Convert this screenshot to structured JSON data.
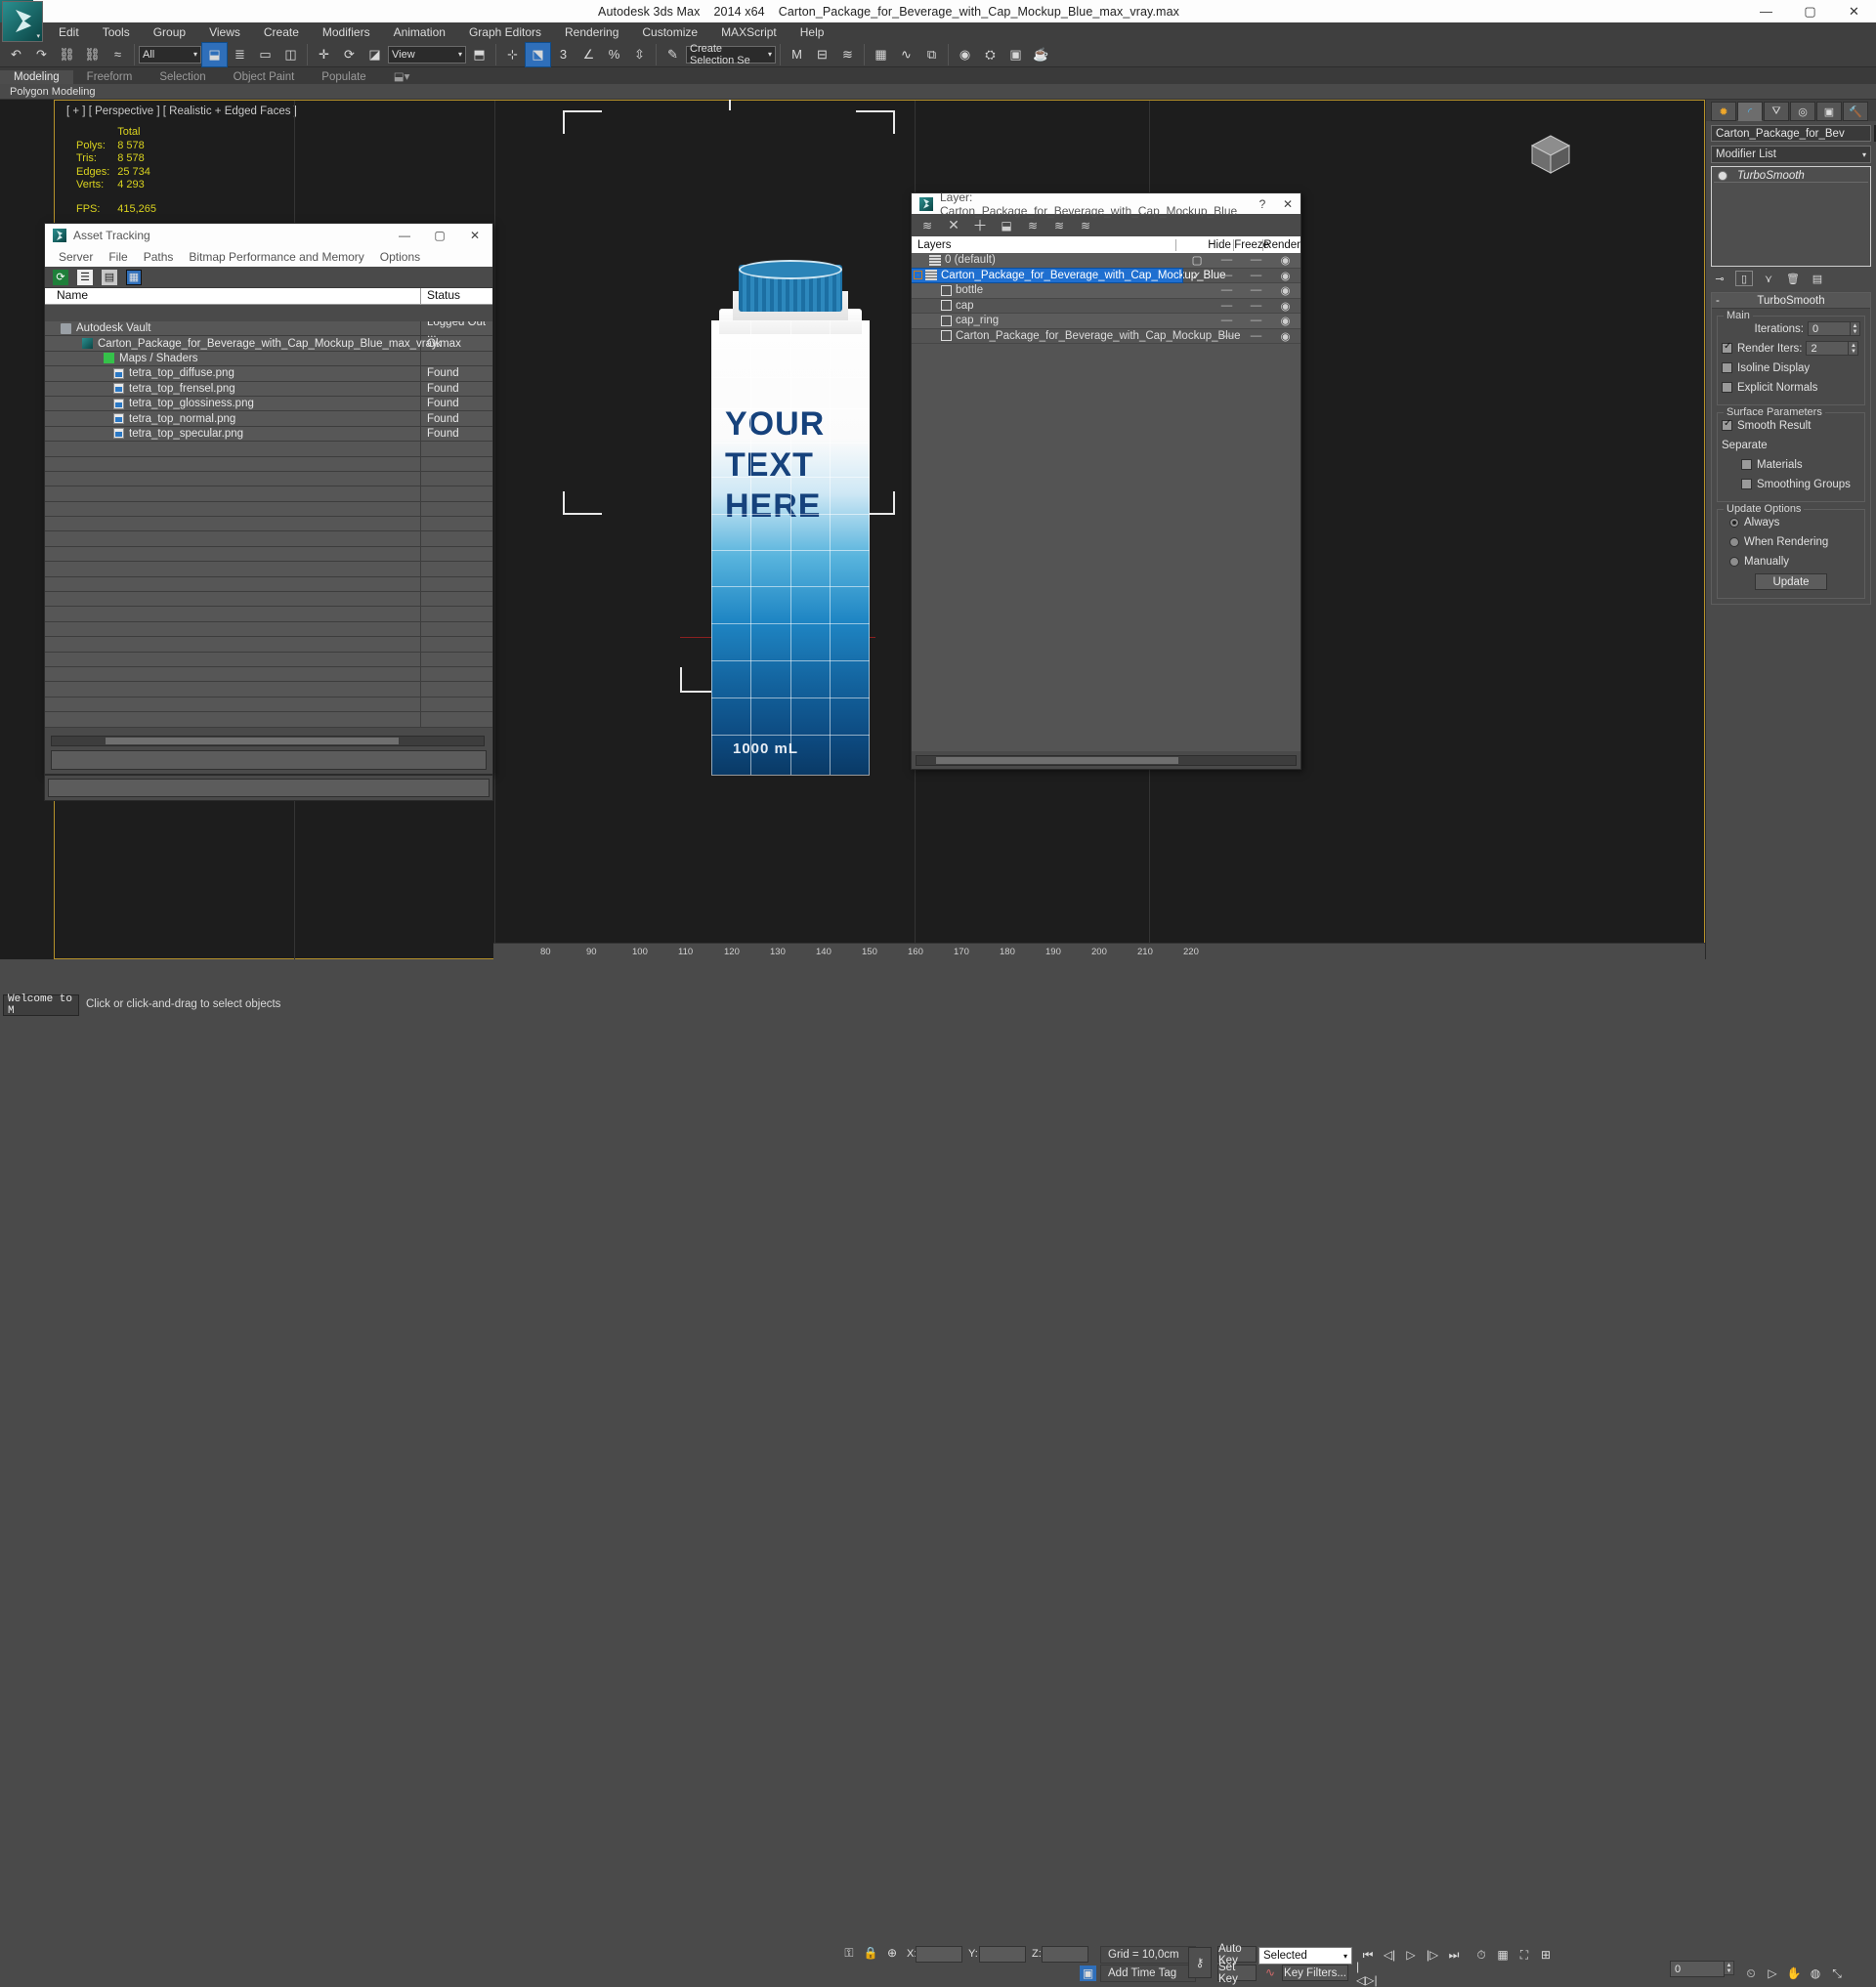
{
  "titlebar": {
    "app": "Autodesk 3ds Max",
    "version": "2014 x64",
    "file": "Carton_Package_for_Beverage_with_Cap_Mockup_Blue_max_vray.max",
    "minimize": "—",
    "maximize": "▢",
    "close": "✕"
  },
  "menu": {
    "items": [
      "Edit",
      "Tools",
      "Group",
      "Views",
      "Create",
      "Modifiers",
      "Animation",
      "Graph Editors",
      "Rendering",
      "Customize",
      "MAXScript",
      "Help"
    ]
  },
  "toolbar": {
    "selection_filter": "All",
    "reference_coord": "View",
    "named_selection_set": "Create Selection Se",
    "percent_label": "%",
    "angle_label": "3"
  },
  "ribbon": {
    "tabs": [
      "Modeling",
      "Freeform",
      "Selection",
      "Object Paint",
      "Populate"
    ],
    "active_tab": "Modeling",
    "subtitle": "Polygon Modeling"
  },
  "viewport": {
    "label": "[ + ] [ Perspective ] [ Realistic + Edged Faces ]",
    "stats_header": "Total",
    "stats": [
      {
        "label": "Polys:",
        "value": "8 578"
      },
      {
        "label": "Tris:",
        "value": "8 578"
      },
      {
        "label": "Edges:",
        "value": "25 734"
      },
      {
        "label": "Verts:",
        "value": "4 293"
      },
      {
        "label": "FPS:",
        "value": "415,265"
      }
    ],
    "carton_text_lines": [
      "YOUR",
      "TEXT",
      "HERE"
    ],
    "carton_volume": "1000 mL"
  },
  "asset_tracking": {
    "title": "Asset Tracking",
    "min": "—",
    "max": "▢",
    "close": "✕",
    "menu": [
      "Server",
      "File",
      "Paths",
      "Bitmap Performance and Memory",
      "Options"
    ],
    "columns": [
      "Name",
      "Status"
    ],
    "rows": [
      {
        "name": "Autodesk Vault",
        "status": "Logged Out ...",
        "icon": "vault-icon",
        "indent": 1
      },
      {
        "name": "Carton_Package_for_Beverage_with_Cap_Mockup_Blue_max_vray.max",
        "status": "Ok",
        "icon": "max-file-icon",
        "indent": 2
      },
      {
        "name": "Maps / Shaders",
        "status": "",
        "icon": "maps-icon",
        "indent": 3
      },
      {
        "name": "tetra_top_diffuse.png",
        "status": "Found",
        "icon": "png-icon",
        "indent": 4
      },
      {
        "name": "tetra_top_frensel.png",
        "status": "Found",
        "icon": "png-icon",
        "indent": 4
      },
      {
        "name": "tetra_top_glossiness.png",
        "status": "Found",
        "icon": "png-icon",
        "indent": 4
      },
      {
        "name": "tetra_top_normal.png",
        "status": "Found",
        "icon": "png-icon",
        "indent": 4
      },
      {
        "name": "tetra_top_specular.png",
        "status": "Found",
        "icon": "png-icon",
        "indent": 4
      }
    ]
  },
  "layer_window": {
    "title": "Layer: Carton_Package_for_Beverage_with_Cap_Mockup_Blue",
    "help": "?",
    "close": "✕",
    "columns": {
      "layers": "Layers",
      "hide": "Hide",
      "freeze": "Freeze",
      "render": "Render"
    },
    "rows": [
      {
        "name": "0 (default)",
        "type": "layer",
        "indent": 1,
        "expand": "",
        "mark": "▢",
        "hide": "—",
        "freeze": "—",
        "render": "◉",
        "selected": false
      },
      {
        "name": "Carton_Package_for_Beverage_with_Cap_Mockup_Blue",
        "type": "layer",
        "indent": 0,
        "expand": "-",
        "mark": "✓",
        "hide": "—",
        "freeze": "—",
        "render": "◉",
        "selected": true
      },
      {
        "name": "bottle",
        "type": "object",
        "indent": 2,
        "expand": "",
        "mark": "",
        "hide": "—",
        "freeze": "—",
        "render": "◉",
        "selected": false
      },
      {
        "name": "cap",
        "type": "object",
        "indent": 2,
        "expand": "",
        "mark": "",
        "hide": "—",
        "freeze": "—",
        "render": "◉",
        "selected": false
      },
      {
        "name": "cap_ring",
        "type": "object",
        "indent": 2,
        "expand": "",
        "mark": "",
        "hide": "—",
        "freeze": "—",
        "render": "◉",
        "selected": false
      },
      {
        "name": "Carton_Package_for_Beverage_with_Cap_Mockup_Blue",
        "type": "object",
        "indent": 2,
        "expand": "",
        "mark": "",
        "hide": "—",
        "freeze": "—",
        "render": "◉",
        "selected": false
      }
    ]
  },
  "command_panel": {
    "object_name": "Carton_Package_for_Bev",
    "object_color": "#5fc2c2",
    "modifier_list": "Modifier List",
    "stack": [
      "TurboSmooth"
    ],
    "rollout_title": "TurboSmooth",
    "rollout_minus": "-",
    "main_group": "Main",
    "iterations_label": "Iterations:",
    "iterations_value": "0",
    "render_iters_label": "Render Iters:",
    "render_iters_value": "2",
    "render_iters_checked": true,
    "isoline_display": "Isoline Display",
    "isoline_checked": false,
    "explicit_normals": "Explicit Normals",
    "explicit_checked": false,
    "surface_group": "Surface Parameters",
    "smooth_result": "Smooth Result",
    "smooth_checked": true,
    "separate_label": "Separate",
    "materials_label": "Materials",
    "materials_checked": false,
    "smoothing_groups_label": "Smoothing Groups",
    "smoothing_groups_checked": false,
    "update_group": "Update Options",
    "update_options": [
      {
        "label": "Always",
        "on": true
      },
      {
        "label": "When Rendering",
        "on": false
      },
      {
        "label": "Manually",
        "on": false
      }
    ],
    "update_button": "Update"
  },
  "ruler": {
    "ticks": [
      "80",
      "90",
      "100",
      "110",
      "120",
      "130",
      "140",
      "150",
      "160",
      "170",
      "180",
      "190",
      "200",
      "210",
      "220"
    ]
  },
  "statusbar": {
    "welcome": "Welcome to M",
    "prompt": "Click or click-and-drag to select objects",
    "x_label": "X:",
    "x_value": "",
    "y_label": "Y:",
    "y_value": "",
    "z_label": "Z:",
    "z_value": "",
    "grid": "Grid = 10,0cm",
    "add_time_tag": "Add Time Tag",
    "auto_key": "Auto Key",
    "set_key": "Set Key",
    "key_filters": "Key Filters...",
    "selection_mode": "Selected",
    "frame_value": "0"
  }
}
